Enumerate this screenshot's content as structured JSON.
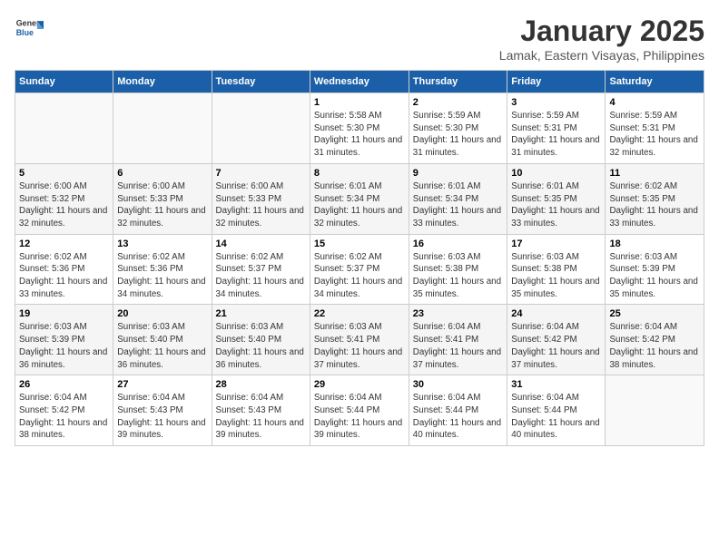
{
  "header": {
    "logo_line1": "General",
    "logo_line2": "Blue",
    "month": "January 2025",
    "location": "Lamak, Eastern Visayas, Philippines"
  },
  "weekdays": [
    "Sunday",
    "Monday",
    "Tuesday",
    "Wednesday",
    "Thursday",
    "Friday",
    "Saturday"
  ],
  "weeks": [
    [
      {
        "day": "",
        "info": ""
      },
      {
        "day": "",
        "info": ""
      },
      {
        "day": "",
        "info": ""
      },
      {
        "day": "1",
        "info": "Sunrise: 5:58 AM\nSunset: 5:30 PM\nDaylight: 11 hours and 31 minutes."
      },
      {
        "day": "2",
        "info": "Sunrise: 5:59 AM\nSunset: 5:30 PM\nDaylight: 11 hours and 31 minutes."
      },
      {
        "day": "3",
        "info": "Sunrise: 5:59 AM\nSunset: 5:31 PM\nDaylight: 11 hours and 31 minutes."
      },
      {
        "day": "4",
        "info": "Sunrise: 5:59 AM\nSunset: 5:31 PM\nDaylight: 11 hours and 32 minutes."
      }
    ],
    [
      {
        "day": "5",
        "info": "Sunrise: 6:00 AM\nSunset: 5:32 PM\nDaylight: 11 hours and 32 minutes."
      },
      {
        "day": "6",
        "info": "Sunrise: 6:00 AM\nSunset: 5:33 PM\nDaylight: 11 hours and 32 minutes."
      },
      {
        "day": "7",
        "info": "Sunrise: 6:00 AM\nSunset: 5:33 PM\nDaylight: 11 hours and 32 minutes."
      },
      {
        "day": "8",
        "info": "Sunrise: 6:01 AM\nSunset: 5:34 PM\nDaylight: 11 hours and 32 minutes."
      },
      {
        "day": "9",
        "info": "Sunrise: 6:01 AM\nSunset: 5:34 PM\nDaylight: 11 hours and 33 minutes."
      },
      {
        "day": "10",
        "info": "Sunrise: 6:01 AM\nSunset: 5:35 PM\nDaylight: 11 hours and 33 minutes."
      },
      {
        "day": "11",
        "info": "Sunrise: 6:02 AM\nSunset: 5:35 PM\nDaylight: 11 hours and 33 minutes."
      }
    ],
    [
      {
        "day": "12",
        "info": "Sunrise: 6:02 AM\nSunset: 5:36 PM\nDaylight: 11 hours and 33 minutes."
      },
      {
        "day": "13",
        "info": "Sunrise: 6:02 AM\nSunset: 5:36 PM\nDaylight: 11 hours and 34 minutes."
      },
      {
        "day": "14",
        "info": "Sunrise: 6:02 AM\nSunset: 5:37 PM\nDaylight: 11 hours and 34 minutes."
      },
      {
        "day": "15",
        "info": "Sunrise: 6:02 AM\nSunset: 5:37 PM\nDaylight: 11 hours and 34 minutes."
      },
      {
        "day": "16",
        "info": "Sunrise: 6:03 AM\nSunset: 5:38 PM\nDaylight: 11 hours and 35 minutes."
      },
      {
        "day": "17",
        "info": "Sunrise: 6:03 AM\nSunset: 5:38 PM\nDaylight: 11 hours and 35 minutes."
      },
      {
        "day": "18",
        "info": "Sunrise: 6:03 AM\nSunset: 5:39 PM\nDaylight: 11 hours and 35 minutes."
      }
    ],
    [
      {
        "day": "19",
        "info": "Sunrise: 6:03 AM\nSunset: 5:39 PM\nDaylight: 11 hours and 36 minutes."
      },
      {
        "day": "20",
        "info": "Sunrise: 6:03 AM\nSunset: 5:40 PM\nDaylight: 11 hours and 36 minutes."
      },
      {
        "day": "21",
        "info": "Sunrise: 6:03 AM\nSunset: 5:40 PM\nDaylight: 11 hours and 36 minutes."
      },
      {
        "day": "22",
        "info": "Sunrise: 6:03 AM\nSunset: 5:41 PM\nDaylight: 11 hours and 37 minutes."
      },
      {
        "day": "23",
        "info": "Sunrise: 6:04 AM\nSunset: 5:41 PM\nDaylight: 11 hours and 37 minutes."
      },
      {
        "day": "24",
        "info": "Sunrise: 6:04 AM\nSunset: 5:42 PM\nDaylight: 11 hours and 37 minutes."
      },
      {
        "day": "25",
        "info": "Sunrise: 6:04 AM\nSunset: 5:42 PM\nDaylight: 11 hours and 38 minutes."
      }
    ],
    [
      {
        "day": "26",
        "info": "Sunrise: 6:04 AM\nSunset: 5:42 PM\nDaylight: 11 hours and 38 minutes."
      },
      {
        "day": "27",
        "info": "Sunrise: 6:04 AM\nSunset: 5:43 PM\nDaylight: 11 hours and 39 minutes."
      },
      {
        "day": "28",
        "info": "Sunrise: 6:04 AM\nSunset: 5:43 PM\nDaylight: 11 hours and 39 minutes."
      },
      {
        "day": "29",
        "info": "Sunrise: 6:04 AM\nSunset: 5:44 PM\nDaylight: 11 hours and 39 minutes."
      },
      {
        "day": "30",
        "info": "Sunrise: 6:04 AM\nSunset: 5:44 PM\nDaylight: 11 hours and 40 minutes."
      },
      {
        "day": "31",
        "info": "Sunrise: 6:04 AM\nSunset: 5:44 PM\nDaylight: 11 hours and 40 minutes."
      },
      {
        "day": "",
        "info": ""
      }
    ]
  ]
}
